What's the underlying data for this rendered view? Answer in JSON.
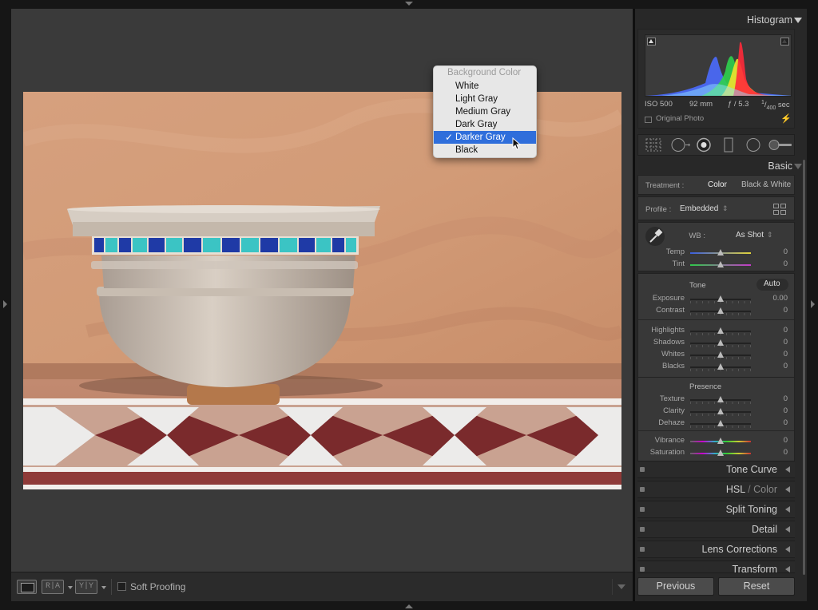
{
  "background_menu": {
    "title": "Background Color",
    "items": [
      "White",
      "Light Gray",
      "Medium Gray",
      "Dark Gray",
      "Darker Gray",
      "Black"
    ],
    "selected": "Darker Gray",
    "check": "✓"
  },
  "toolbar": {
    "view_ra": "R|A",
    "view_yy": "Y|Y",
    "soft_proofing": "Soft Proofing"
  },
  "histogram": {
    "title": "Histogram",
    "iso": "ISO 500",
    "focal": "92 mm",
    "aperture": "ƒ / 5.3",
    "shutter_num": "1",
    "shutter_den": "400",
    "shutter_unit": "sec",
    "original_photo": "Original Photo"
  },
  "basic": {
    "title": "Basic",
    "treatment_label": "Treatment :",
    "treatment_color": "Color",
    "treatment_bw": "Black & White",
    "profile_label": "Profile :",
    "profile_value": "Embedded",
    "profile_arrows": "⇕",
    "wb_label": "WB :",
    "wb_value": "As Shot",
    "wb_arrows": "⇕",
    "temp_label": "Temp",
    "temp_value": "0",
    "tint_label": "Tint",
    "tint_value": "0",
    "tone_label": "Tone",
    "auto_label": "Auto",
    "exposure_label": "Exposure",
    "exposure_value": "0.00",
    "contrast_label": "Contrast",
    "contrast_value": "0",
    "highlights_label": "Highlights",
    "highlights_value": "0",
    "shadows_label": "Shadows",
    "shadows_value": "0",
    "whites_label": "Whites",
    "whites_value": "0",
    "blacks_label": "Blacks",
    "blacks_value": "0",
    "presence_label": "Presence",
    "texture_label": "Texture",
    "texture_value": "0",
    "clarity_label": "Clarity",
    "clarity_value": "0",
    "dehaze_label": "Dehaze",
    "dehaze_value": "0",
    "vibrance_label": "Vibrance",
    "vibrance_value": "0",
    "saturation_label": "Saturation",
    "saturation_value": "0"
  },
  "collapsed_panels": {
    "tone_curve": "Tone Curve",
    "hsl": "HSL",
    "hsl_sep": " / ",
    "hsl_color": "Color",
    "split_toning": "Split Toning",
    "detail": "Detail",
    "lens_corrections": "Lens Corrections",
    "transform": "Transform"
  },
  "buttons": {
    "previous": "Previous",
    "reset": "Reset"
  },
  "colors": {
    "accent": "#2f6edb",
    "workspace_bg": "#3a3a3a",
    "panel_bg": "#282828"
  }
}
